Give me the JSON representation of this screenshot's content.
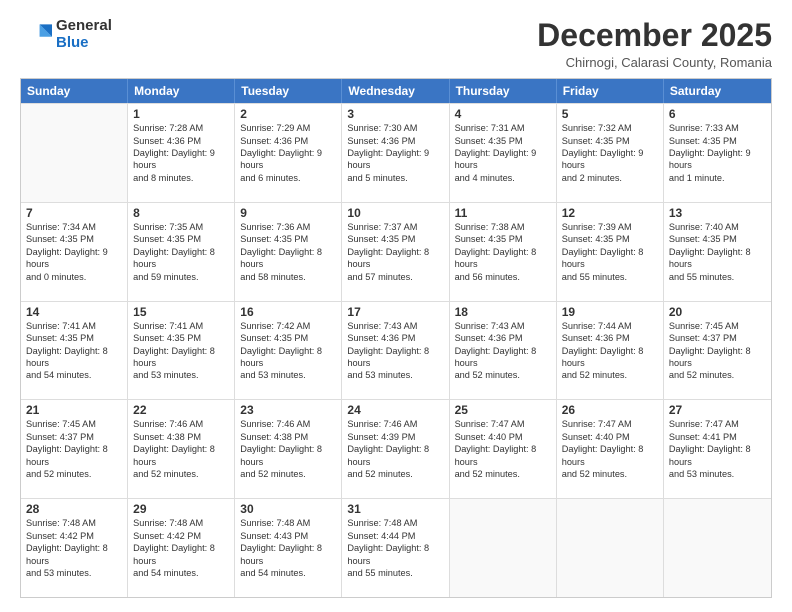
{
  "logo": {
    "general": "General",
    "blue": "Blue"
  },
  "title": "December 2025",
  "location": "Chirnogi, Calarasi County, Romania",
  "header_days": [
    "Sunday",
    "Monday",
    "Tuesday",
    "Wednesday",
    "Thursday",
    "Friday",
    "Saturday"
  ],
  "weeks": [
    [
      {
        "day": "",
        "sunrise": "",
        "sunset": "",
        "daylight": ""
      },
      {
        "day": "1",
        "sunrise": "Sunrise: 7:28 AM",
        "sunset": "Sunset: 4:36 PM",
        "daylight": "Daylight: 9 hours and 8 minutes."
      },
      {
        "day": "2",
        "sunrise": "Sunrise: 7:29 AM",
        "sunset": "Sunset: 4:36 PM",
        "daylight": "Daylight: 9 hours and 6 minutes."
      },
      {
        "day": "3",
        "sunrise": "Sunrise: 7:30 AM",
        "sunset": "Sunset: 4:36 PM",
        "daylight": "Daylight: 9 hours and 5 minutes."
      },
      {
        "day": "4",
        "sunrise": "Sunrise: 7:31 AM",
        "sunset": "Sunset: 4:35 PM",
        "daylight": "Daylight: 9 hours and 4 minutes."
      },
      {
        "day": "5",
        "sunrise": "Sunrise: 7:32 AM",
        "sunset": "Sunset: 4:35 PM",
        "daylight": "Daylight: 9 hours and 2 minutes."
      },
      {
        "day": "6",
        "sunrise": "Sunrise: 7:33 AM",
        "sunset": "Sunset: 4:35 PM",
        "daylight": "Daylight: 9 hours and 1 minute."
      }
    ],
    [
      {
        "day": "7",
        "sunrise": "Sunrise: 7:34 AM",
        "sunset": "Sunset: 4:35 PM",
        "daylight": "Daylight: 9 hours and 0 minutes."
      },
      {
        "day": "8",
        "sunrise": "Sunrise: 7:35 AM",
        "sunset": "Sunset: 4:35 PM",
        "daylight": "Daylight: 8 hours and 59 minutes."
      },
      {
        "day": "9",
        "sunrise": "Sunrise: 7:36 AM",
        "sunset": "Sunset: 4:35 PM",
        "daylight": "Daylight: 8 hours and 58 minutes."
      },
      {
        "day": "10",
        "sunrise": "Sunrise: 7:37 AM",
        "sunset": "Sunset: 4:35 PM",
        "daylight": "Daylight: 8 hours and 57 minutes."
      },
      {
        "day": "11",
        "sunrise": "Sunrise: 7:38 AM",
        "sunset": "Sunset: 4:35 PM",
        "daylight": "Daylight: 8 hours and 56 minutes."
      },
      {
        "day": "12",
        "sunrise": "Sunrise: 7:39 AM",
        "sunset": "Sunset: 4:35 PM",
        "daylight": "Daylight: 8 hours and 55 minutes."
      },
      {
        "day": "13",
        "sunrise": "Sunrise: 7:40 AM",
        "sunset": "Sunset: 4:35 PM",
        "daylight": "Daylight: 8 hours and 55 minutes."
      }
    ],
    [
      {
        "day": "14",
        "sunrise": "Sunrise: 7:41 AM",
        "sunset": "Sunset: 4:35 PM",
        "daylight": "Daylight: 8 hours and 54 minutes."
      },
      {
        "day": "15",
        "sunrise": "Sunrise: 7:41 AM",
        "sunset": "Sunset: 4:35 PM",
        "daylight": "Daylight: 8 hours and 53 minutes."
      },
      {
        "day": "16",
        "sunrise": "Sunrise: 7:42 AM",
        "sunset": "Sunset: 4:35 PM",
        "daylight": "Daylight: 8 hours and 53 minutes."
      },
      {
        "day": "17",
        "sunrise": "Sunrise: 7:43 AM",
        "sunset": "Sunset: 4:36 PM",
        "daylight": "Daylight: 8 hours and 53 minutes."
      },
      {
        "day": "18",
        "sunrise": "Sunrise: 7:43 AM",
        "sunset": "Sunset: 4:36 PM",
        "daylight": "Daylight: 8 hours and 52 minutes."
      },
      {
        "day": "19",
        "sunrise": "Sunrise: 7:44 AM",
        "sunset": "Sunset: 4:36 PM",
        "daylight": "Daylight: 8 hours and 52 minutes."
      },
      {
        "day": "20",
        "sunrise": "Sunrise: 7:45 AM",
        "sunset": "Sunset: 4:37 PM",
        "daylight": "Daylight: 8 hours and 52 minutes."
      }
    ],
    [
      {
        "day": "21",
        "sunrise": "Sunrise: 7:45 AM",
        "sunset": "Sunset: 4:37 PM",
        "daylight": "Daylight: 8 hours and 52 minutes."
      },
      {
        "day": "22",
        "sunrise": "Sunrise: 7:46 AM",
        "sunset": "Sunset: 4:38 PM",
        "daylight": "Daylight: 8 hours and 52 minutes."
      },
      {
        "day": "23",
        "sunrise": "Sunrise: 7:46 AM",
        "sunset": "Sunset: 4:38 PM",
        "daylight": "Daylight: 8 hours and 52 minutes."
      },
      {
        "day": "24",
        "sunrise": "Sunrise: 7:46 AM",
        "sunset": "Sunset: 4:39 PM",
        "daylight": "Daylight: 8 hours and 52 minutes."
      },
      {
        "day": "25",
        "sunrise": "Sunrise: 7:47 AM",
        "sunset": "Sunset: 4:40 PM",
        "daylight": "Daylight: 8 hours and 52 minutes."
      },
      {
        "day": "26",
        "sunrise": "Sunrise: 7:47 AM",
        "sunset": "Sunset: 4:40 PM",
        "daylight": "Daylight: 8 hours and 52 minutes."
      },
      {
        "day": "27",
        "sunrise": "Sunrise: 7:47 AM",
        "sunset": "Sunset: 4:41 PM",
        "daylight": "Daylight: 8 hours and 53 minutes."
      }
    ],
    [
      {
        "day": "28",
        "sunrise": "Sunrise: 7:48 AM",
        "sunset": "Sunset: 4:42 PM",
        "daylight": "Daylight: 8 hours and 53 minutes."
      },
      {
        "day": "29",
        "sunrise": "Sunrise: 7:48 AM",
        "sunset": "Sunset: 4:42 PM",
        "daylight": "Daylight: 8 hours and 54 minutes."
      },
      {
        "day": "30",
        "sunrise": "Sunrise: 7:48 AM",
        "sunset": "Sunset: 4:43 PM",
        "daylight": "Daylight: 8 hours and 54 minutes."
      },
      {
        "day": "31",
        "sunrise": "Sunrise: 7:48 AM",
        "sunset": "Sunset: 4:44 PM",
        "daylight": "Daylight: 8 hours and 55 minutes."
      },
      {
        "day": "",
        "sunrise": "",
        "sunset": "",
        "daylight": ""
      },
      {
        "day": "",
        "sunrise": "",
        "sunset": "",
        "daylight": ""
      },
      {
        "day": "",
        "sunrise": "",
        "sunset": "",
        "daylight": ""
      }
    ]
  ]
}
